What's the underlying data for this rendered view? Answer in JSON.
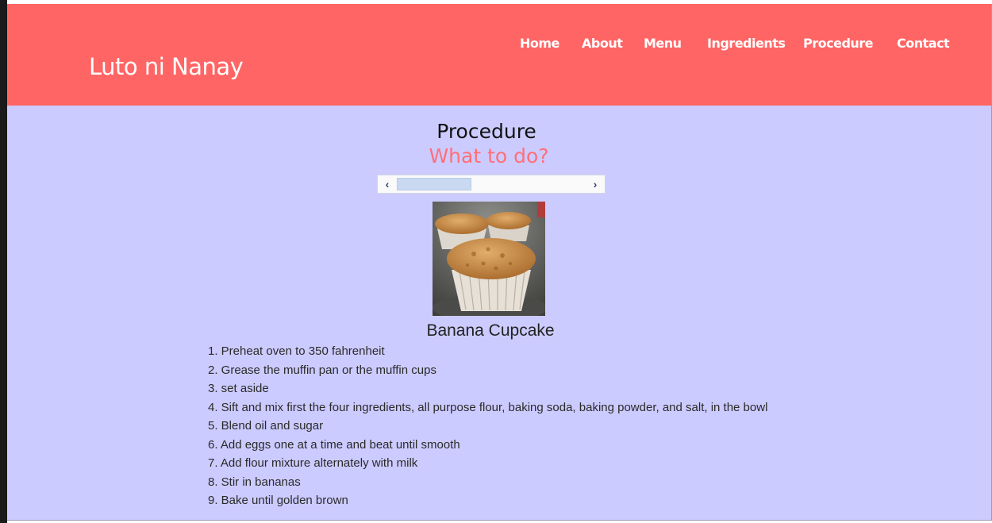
{
  "site": {
    "brand": "Luto ni Nanay",
    "nav": [
      "Home",
      "About",
      "Menu",
      "Ingredients",
      "Procedure",
      "Contact"
    ]
  },
  "main": {
    "title": "Procedure",
    "subtitle": "What to do?",
    "carousel": {
      "prev_icon": "chevron-left-icon",
      "next_icon": "chevron-right-icon",
      "position_fraction": 0.4
    },
    "recipe": {
      "image": "banana-cupcake-photo",
      "name": "Banana Cupcake",
      "steps": [
        "1. Preheat oven to 350 fahrenheit",
        "2. Grease the muffin pan or the muffin cups",
        "3. set aside",
        "4. Sift and mix first the four ingredients, all purpose flour, baking soda, baking powder, and salt, in the bowl",
        "5. Blend oil and sugar",
        "6. Add eggs one at a time and beat until smooth",
        "7. Add flour mixture alternately with milk",
        "8. Stir in bananas",
        "9. Bake until golden brown"
      ]
    }
  },
  "colors": {
    "header": "#ff6565",
    "background": "#cccbff",
    "subtitle": "#ff6f78"
  }
}
